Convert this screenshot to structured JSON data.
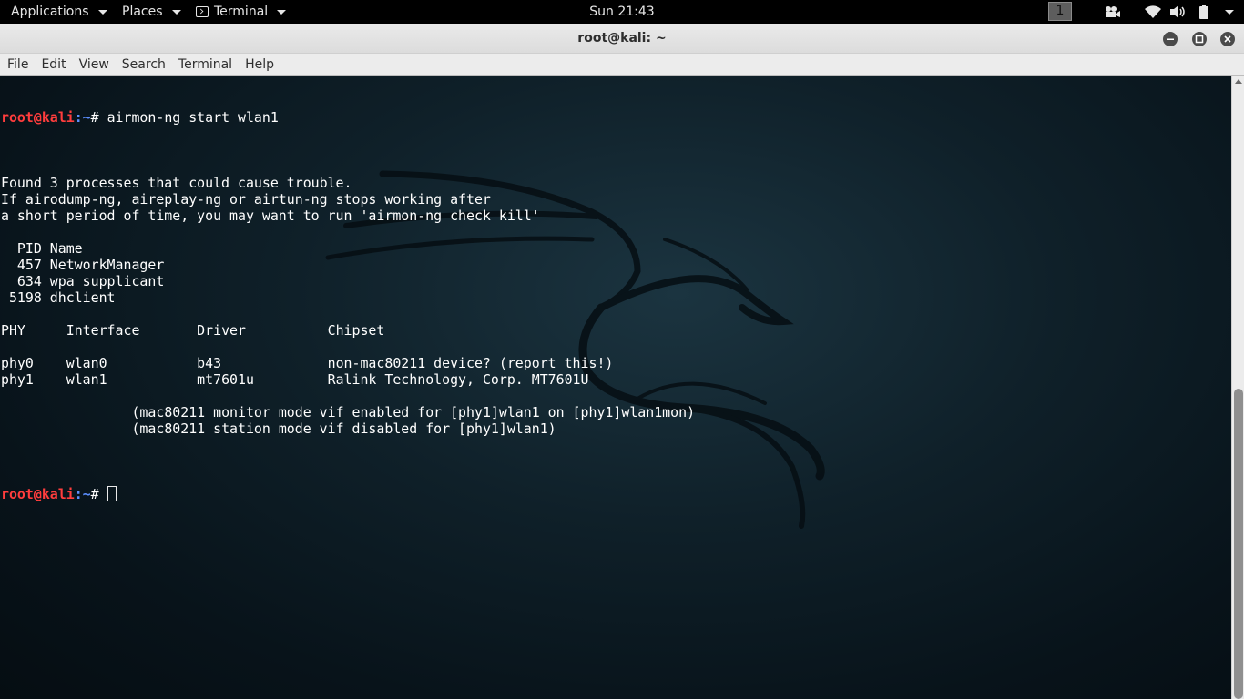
{
  "panel": {
    "applications_label": "Applications",
    "places_label": "Places",
    "active_app_label": "Terminal",
    "clock": "Sun 21:43",
    "workspace": "1"
  },
  "window": {
    "title": "root@kali: ~"
  },
  "menubar": {
    "items": [
      "File",
      "Edit",
      "View",
      "Search",
      "Terminal",
      "Help"
    ]
  },
  "terminal": {
    "prompt_user": "root@kali",
    "prompt_path": ":~",
    "prompt_symbol": "# ",
    "command": "airmon-ng start wlan1",
    "output": [
      "",
      "Found 3 processes that could cause trouble.",
      "If airodump-ng, aireplay-ng or airtun-ng stops working after",
      "a short period of time, you may want to run 'airmon-ng check kill'",
      "",
      "  PID Name",
      "  457 NetworkManager",
      "  634 wpa_supplicant",
      " 5198 dhclient",
      "",
      "PHY\tInterface\tDriver\t\tChipset",
      "",
      "phy0\twlan0\t\tb43\t\tnon-mac80211 device? (report this!)",
      "phy1\twlan1\t\tmt7601u\t\tRalink Technology, Corp. MT7601U",
      "",
      "\t\t(mac80211 monitor mode vif enabled for [phy1]wlan1 on [phy1]wlan1mon)",
      "\t\t(mac80211 station mode vif disabled for [phy1]wlan1)",
      ""
    ]
  },
  "icons": {
    "applications_arrow": "chevron-down-icon",
    "terminal": "terminal-icon",
    "video": "video-camera-icon",
    "wifi": "wifi-icon",
    "volume": "volume-icon",
    "battery": "battery-icon",
    "system_menu": "chevron-down-icon",
    "minimize": "minimize-icon",
    "maximize": "maximize-icon",
    "close": "close-icon"
  },
  "colors": {
    "prompt_user": "#ff3d3d",
    "prompt_path": "#5c8fff",
    "terminal_bg": "#0f2029"
  }
}
